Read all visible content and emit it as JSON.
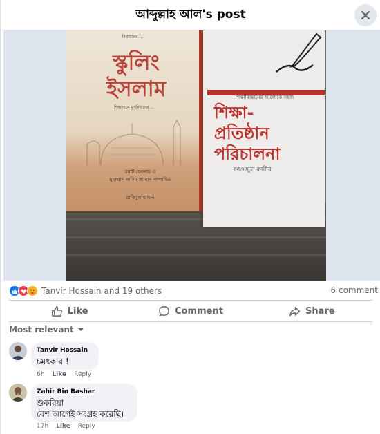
{
  "header": {
    "title": "আব্দুল্লাহ আল's post"
  },
  "photo": {
    "book_left": {
      "top_line": "বিশ্বায়নের ...",
      "title_line1": "স্কুলিং",
      "title_line2": "ইসলাম",
      "subtitle": "শিক্ষাদানে মুসলিমদের ...",
      "authors_line1": "রবার্ট হেফনার ও",
      "authors_line2": "মুহাম্মাদ কাসিম জামান সম্পাদিত",
      "translator": "রাকিবুল হাসান"
    },
    "book_right": {
      "band_text": "শিক্ষাবিজ্ঞানের আলোকে সহজ",
      "title_line1": "শিক্ষা-",
      "title_line2": "প্রতিষ্ঠান",
      "title_line3": "পরিচালনা",
      "author": "ফাওজুল কাবীর"
    }
  },
  "reactions": {
    "names": "Tanvir Hossain and 19 others",
    "comment_count": "6 comment",
    "colors": {
      "like": "#1877f2",
      "love": "#f33e58",
      "care": "#f7b125"
    }
  },
  "actions": {
    "like": "Like",
    "comment": "Comment",
    "share": "Share"
  },
  "filter": {
    "label": "Most relevant"
  },
  "comments": [
    {
      "author": "Tanvir Hossain",
      "text_line1": "চমৎকার !",
      "time": "6h",
      "like": "Like",
      "reply": "Reply"
    },
    {
      "author": "Zahir Bin Bashar",
      "text_line1": "শুকরিয়া",
      "text_line2": "বেশ আগেই সংগ্রহ করেছি।",
      "time": "17h",
      "like": "Like",
      "reply": "Reply"
    }
  ]
}
